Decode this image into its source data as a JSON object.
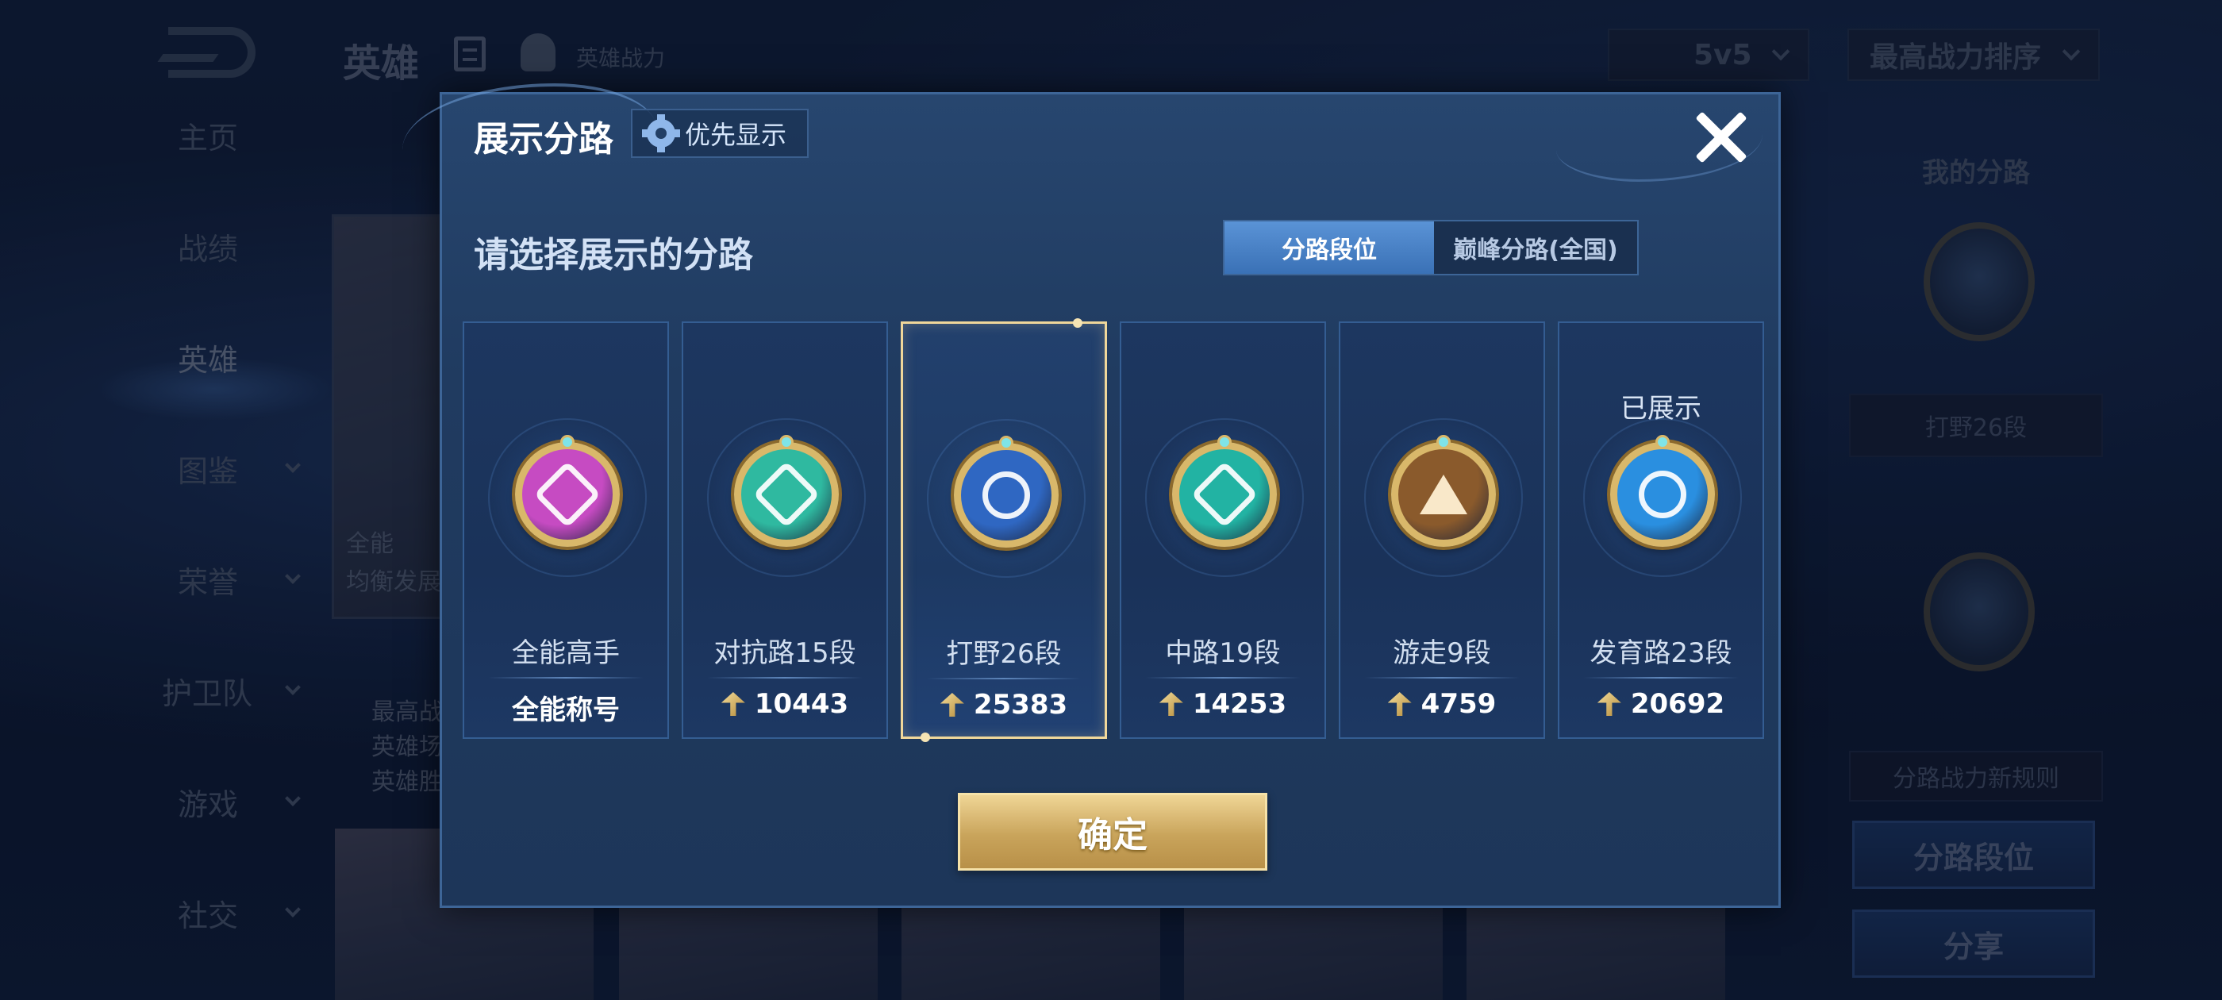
{
  "background": {
    "title": "英雄",
    "hero_power_label": "英雄战力",
    "mode_select": "5v5",
    "sort_select": "最高战力排序",
    "nav": [
      {
        "label": "主页",
        "chevron": false
      },
      {
        "label": "战绩",
        "chevron": false
      },
      {
        "label": "英雄",
        "chevron": false,
        "active": true
      },
      {
        "label": "图鉴",
        "chevron": true
      },
      {
        "label": "荣誉",
        "chevron": true
      },
      {
        "label": "护卫队",
        "chevron": true
      },
      {
        "label": "游戏",
        "chevron": true
      },
      {
        "label": "社交",
        "chevron": true
      }
    ],
    "card_text_1": "全能",
    "card_text_2": "均衡发展",
    "stats_lines": [
      "最高战",
      "英雄场",
      "英雄胜"
    ],
    "right_panel": {
      "title": "我的分路",
      "lane_field": "打野26段",
      "rules": "分路战力新规则",
      "lane_rank_button": "分路段位",
      "share_button": "分享"
    }
  },
  "modal": {
    "title": "展示分路",
    "priority_button": "优先显示",
    "subtitle": "请选择展示的分路",
    "tabs": [
      {
        "label": "分路段位",
        "active": true
      },
      {
        "label": "巅峰分路(全国)",
        "active": false
      }
    ],
    "lanes": [
      {
        "name": "全能高手",
        "value": "全能称号",
        "show_power_icon": false,
        "color": "#c64bc2",
        "icon": "all-round-icon",
        "selected": false,
        "shown_label": ""
      },
      {
        "name": "对抗路15段",
        "value": "10443",
        "show_power_icon": true,
        "color": "#2fb9a0",
        "icon": "clash-lane-icon",
        "selected": false,
        "shown_label": ""
      },
      {
        "name": "打野26段",
        "value": "25383",
        "show_power_icon": true,
        "color": "#2f67c2",
        "icon": "jungle-dragon-icon",
        "selected": true,
        "shown_label": ""
      },
      {
        "name": "中路19段",
        "value": "14253",
        "show_power_icon": true,
        "color": "#22b3a3",
        "icon": "mid-lane-icon",
        "selected": false,
        "shown_label": ""
      },
      {
        "name": "游走9段",
        "value": "4759",
        "show_power_icon": true,
        "color": "#8a5a2c",
        "icon": "roam-wings-icon",
        "selected": false,
        "shown_label": ""
      },
      {
        "name": "发育路23段",
        "value": "20692",
        "show_power_icon": true,
        "color": "#2a8fe0",
        "icon": "farm-lane-icon",
        "selected": false,
        "shown_label": "已展示"
      }
    ],
    "confirm_button": "确定"
  }
}
